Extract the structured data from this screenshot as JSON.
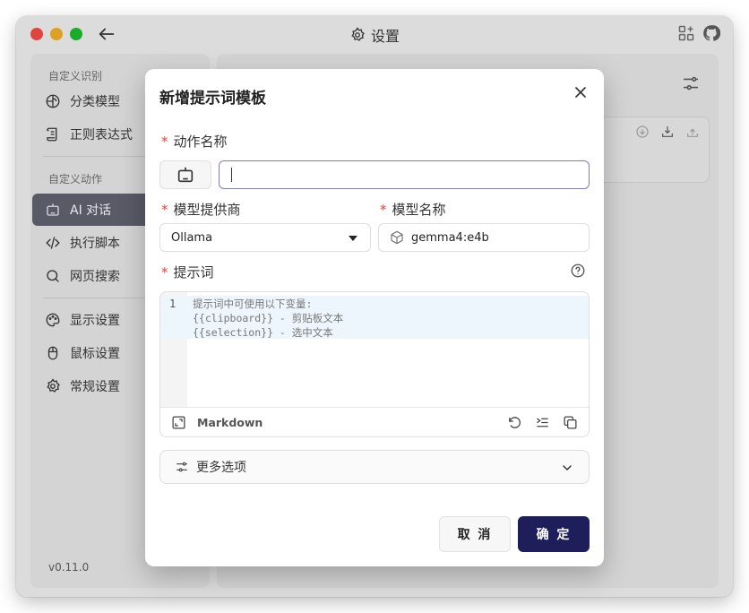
{
  "window": {
    "title": "设置",
    "version": "v0.11.0"
  },
  "sidebar": {
    "groups": [
      {
        "label": "自定义识别",
        "items": [
          {
            "label": "分类模型",
            "icon": "brain-icon"
          },
          {
            "label": "正则表达式",
            "icon": "scroll-icon"
          }
        ]
      },
      {
        "label": "自定义动作",
        "items": [
          {
            "label": "AI 对话",
            "icon": "robot-icon",
            "active": true
          },
          {
            "label": "执行脚本",
            "icon": "code-icon"
          },
          {
            "label": "网页搜索",
            "icon": "search-icon"
          }
        ]
      },
      {
        "label": "",
        "items": [
          {
            "label": "显示设置",
            "icon": "palette-icon"
          },
          {
            "label": "鼠标设置",
            "icon": "mouse-icon"
          },
          {
            "label": "常规设置",
            "icon": "gear-icon"
          }
        ]
      }
    ]
  },
  "modal": {
    "title": "新增提示词模板",
    "action_name_label": "动作名称",
    "action_name_value": "",
    "provider_label": "模型提供商",
    "provider_value": "Ollama",
    "model_label": "模型名称",
    "model_value": "gemma4:e4b",
    "prompt_label": "提示词",
    "editor": {
      "line_number": "1",
      "lines": [
        "提示词中可使用以下变量:",
        "{{clipboard}} - 剪贴板文本",
        "{{selection}} - 选中文本"
      ],
      "language": "Markdown"
    },
    "more_options_label": "更多选项",
    "cancel_label": "取 消",
    "ok_label": "确 定"
  },
  "colors": {
    "accent": "#1e1e5a",
    "required": "#e0443e",
    "focus_border": "#7c7cc8"
  }
}
